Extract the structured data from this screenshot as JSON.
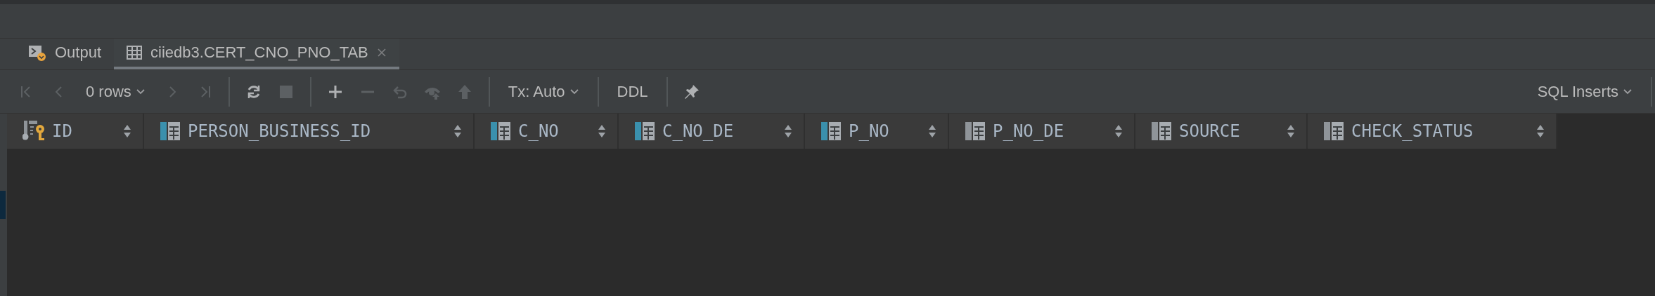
{
  "tabs": [
    {
      "label": "Output",
      "kind": "output",
      "selected": false,
      "closable": false
    },
    {
      "label": "ciiedb3.CERT_CNO_PNO_TAB",
      "kind": "table",
      "selected": true,
      "closable": true
    }
  ],
  "toolbar": [
    {
      "kind": "first",
      "disabled": true
    },
    {
      "kind": "prev",
      "disabled": true
    },
    {
      "kind": "rows",
      "label": "0 rows"
    },
    {
      "kind": "next",
      "disabled": true
    },
    {
      "kind": "last",
      "disabled": true
    },
    {
      "kind": "sep"
    },
    {
      "kind": "refresh",
      "disabled": false
    },
    {
      "kind": "stop",
      "disabled": true
    },
    {
      "kind": "sep"
    },
    {
      "kind": "add",
      "disabled": false
    },
    {
      "kind": "remove",
      "disabled": true
    },
    {
      "kind": "revert",
      "disabled": true
    },
    {
      "kind": "preview",
      "disabled": true
    },
    {
      "kind": "submit",
      "disabled": true
    },
    {
      "kind": "sep"
    },
    {
      "kind": "tx",
      "label": "Tx: Auto"
    },
    {
      "kind": "sep"
    },
    {
      "kind": "ddl",
      "label": "DDL"
    },
    {
      "kind": "sep"
    },
    {
      "kind": "pin",
      "disabled": false
    }
  ],
  "export_format": "SQL Inserts",
  "columns": [
    {
      "name": "ID",
      "kind": "primary_key"
    },
    {
      "name": "PERSON_BUSINESS_ID",
      "kind": "indexed"
    },
    {
      "name": "C_NO",
      "kind": "indexed"
    },
    {
      "name": "C_NO_DE",
      "kind": "indexed"
    },
    {
      "name": "P_NO",
      "kind": "indexed"
    },
    {
      "name": "P_NO_DE",
      "kind": "plain"
    },
    {
      "name": "SOURCE",
      "kind": "plain"
    },
    {
      "name": "CHECK_STATUS",
      "kind": "plain"
    }
  ]
}
